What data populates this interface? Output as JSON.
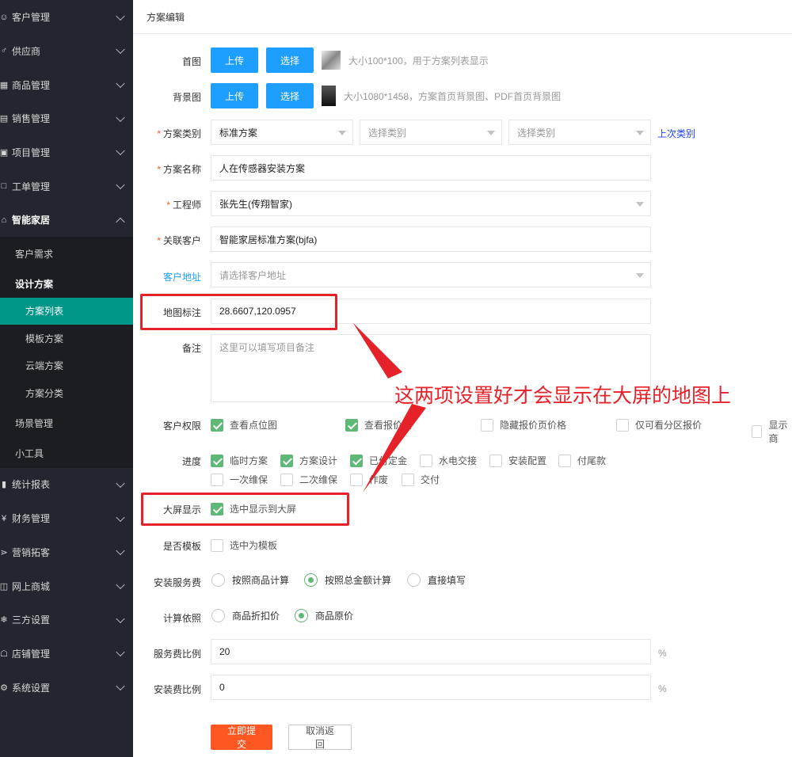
{
  "sidebar": {
    "items": [
      {
        "icon": "user-icon",
        "label": "客户管理"
      },
      {
        "icon": "supplier-icon",
        "label": "供应商"
      },
      {
        "icon": "product-icon",
        "label": "商品管理"
      },
      {
        "icon": "sales-icon",
        "label": "销售管理"
      },
      {
        "icon": "project-icon",
        "label": "项目管理"
      },
      {
        "icon": "workorder-icon",
        "label": "工单管理"
      },
      {
        "icon": "home-icon",
        "label": "智能家居"
      }
    ],
    "sub": {
      "customer_demand": "客户需求",
      "design_plan": "设计方案",
      "plan_list": "方案列表",
      "template_plan": "模板方案",
      "cloud_plan": "云端方案",
      "plan_category": "方案分类",
      "scene_manage": "场景管理",
      "tools": "小工具"
    },
    "items2": [
      {
        "icon": "report-icon",
        "label": "统计报表"
      },
      {
        "icon": "finance-icon",
        "label": "财务管理"
      },
      {
        "icon": "share-icon",
        "label": "营销拓客"
      },
      {
        "icon": "shop-icon",
        "label": "网上商城"
      },
      {
        "icon": "snowflake-icon",
        "label": "三方设置"
      },
      {
        "icon": "store-icon",
        "label": "店铺管理"
      },
      {
        "icon": "gear-icon",
        "label": "系统设置"
      }
    ]
  },
  "header": {
    "title": "方案编辑"
  },
  "form": {
    "cover": {
      "label": "首图",
      "upload": "上传",
      "select": "选择",
      "hint": "大小100*100，用于方案列表显示"
    },
    "bg": {
      "label": "背景图",
      "upload": "上传",
      "select": "选择",
      "hint": "大小1080*1458，方案首页背景图、PDF首页背景图"
    },
    "category": {
      "label": "方案类别",
      "value1": "标准方案",
      "placeholder2": "选择类别",
      "placeholder3": "选择类别",
      "last_link": "上次类别"
    },
    "name": {
      "label": "方案名称",
      "value": "人在传感器安装方案"
    },
    "engineer": {
      "label": "工程师",
      "value": "张先生(传翔智家)"
    },
    "customer": {
      "label": "关联客户",
      "value": "智能家居标准方案(bjfa)"
    },
    "address": {
      "label": "客户地址",
      "placeholder": "请选择客户地址"
    },
    "map": {
      "label": "地图标注",
      "value": "28.6607,120.0957"
    },
    "remark": {
      "label": "备注",
      "placeholder": "这里可以填写项目备注"
    },
    "permission": {
      "label": "客户权限",
      "options": [
        "查看点位图",
        "查看报价页",
        "隐藏报价页价格",
        "仅可看分区报价",
        "显示商"
      ]
    },
    "progress": {
      "label": "进度",
      "row1": [
        "临时方案",
        "方案设计",
        "已付定金",
        "水电交接",
        "安装配置",
        "付尾款"
      ],
      "row2": [
        "一次维保",
        "二次维保",
        "作废",
        "交付"
      ]
    },
    "bigscreen": {
      "label": "大屏显示",
      "option": "选中显示到大屏"
    },
    "template": {
      "label": "是否模板",
      "option": "选中为模板"
    },
    "install_fee": {
      "label": "安装服务费",
      "options": [
        "按照商品计算",
        "按照总金额计算",
        "直接填写"
      ]
    },
    "basis": {
      "label": "计算依照",
      "options": [
        "商品折扣价",
        "商品原价"
      ]
    },
    "service_ratio": {
      "label": "服务费比例",
      "value": "20",
      "unit": "%"
    },
    "install_ratio": {
      "label": "安装费比例",
      "value": "0",
      "unit": "%"
    },
    "submit": "立即提交",
    "cancel": "取消返回"
  },
  "annotation": {
    "text": "这两项设置好才会显示在大屏的地图上",
    "color": "#e5222a"
  },
  "colors": {
    "sidebar": "#23262e",
    "active": "#009688",
    "primary": "#1e9fff",
    "check": "#5fb878",
    "submit": "#ff5722"
  }
}
